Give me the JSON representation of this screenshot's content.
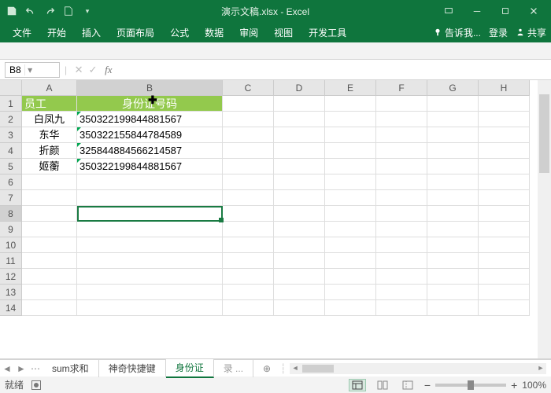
{
  "title": "演示文稿.xlsx - Excel",
  "tabs": {
    "file": "文件",
    "home": "开始",
    "insert": "插入",
    "layout": "页面布局",
    "formula": "公式",
    "data": "数据",
    "review": "审阅",
    "view": "视图",
    "dev": "开发工具"
  },
  "ribbon_right": {
    "tell": "告诉我...",
    "login": "登录",
    "share": "共享"
  },
  "namebox": "B8",
  "columns": [
    "A",
    "B",
    "C",
    "D",
    "E",
    "F",
    "G",
    "H"
  ],
  "col_widths": {
    "A": 70,
    "B": 185,
    "other": 65
  },
  "rows": [
    "1",
    "2",
    "3",
    "4",
    "5",
    "6",
    "7",
    "8",
    "9",
    "10",
    "11",
    "12",
    "13",
    "14"
  ],
  "header_row": {
    "A": "员工",
    "B": "身份证号码"
  },
  "data_rows": [
    {
      "A": "白凤九",
      "B": "350322199844881567"
    },
    {
      "A": "东华",
      "B": "350322155844784589"
    },
    {
      "A": "折颜",
      "B": "325844884566214587"
    },
    {
      "A": "姬蘅",
      "B": "350322199844881567"
    }
  ],
  "selected_cell": "B8",
  "sheet_tabs": {
    "s1": "sum求和",
    "s2": "神奇快捷键",
    "s3": "身份证",
    "s4": "录 ...",
    "new": "⊕"
  },
  "status_text": "就绪",
  "zoom": "100%"
}
